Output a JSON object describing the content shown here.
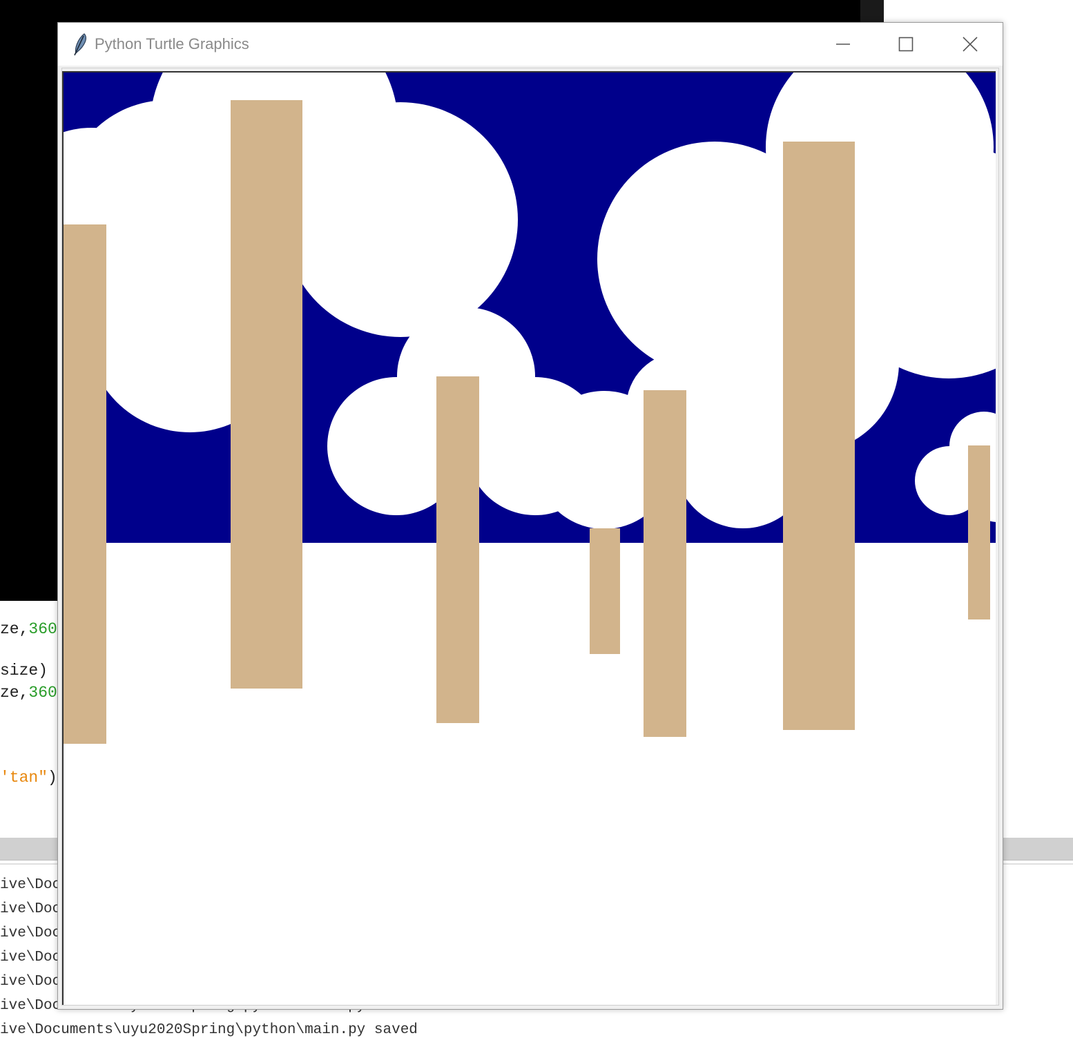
{
  "background": {
    "editor_lines": [
      {
        "pre": "ze,",
        "num": "360",
        "post": ""
      },
      {
        "pre": "size)",
        "num": "",
        "post": ""
      },
      {
        "pre": "ze,",
        "num": "360",
        "post": ""
      },
      {
        "pre": "",
        "str": "'tan\"",
        "post": ")"
      }
    ],
    "console_lines": [
      "ive\\Doc",
      "ive\\Doc",
      "ive\\Doc",
      "ive\\Doc",
      "ive\\Doc",
      "ive\\Documents\\uyu2020Spring\\python\\main.py saved.",
      "ive\\Documents\\uyu2020Spring\\python\\main.py saved"
    ]
  },
  "window": {
    "title": "Python Turtle Graphics",
    "icon": "feather-icon",
    "controls": {
      "minimize": "minimize-icon",
      "maximize": "maximize-icon",
      "close": "close-icon"
    }
  },
  "scene": {
    "colors": {
      "sky": "#00008b",
      "ground": "#ffffff",
      "cloud": "#ffffff",
      "trunk": "#d2b48c"
    },
    "sky_color_name": "navy",
    "trunk_color_name": "tan",
    "cloud_color_name": "white"
  }
}
